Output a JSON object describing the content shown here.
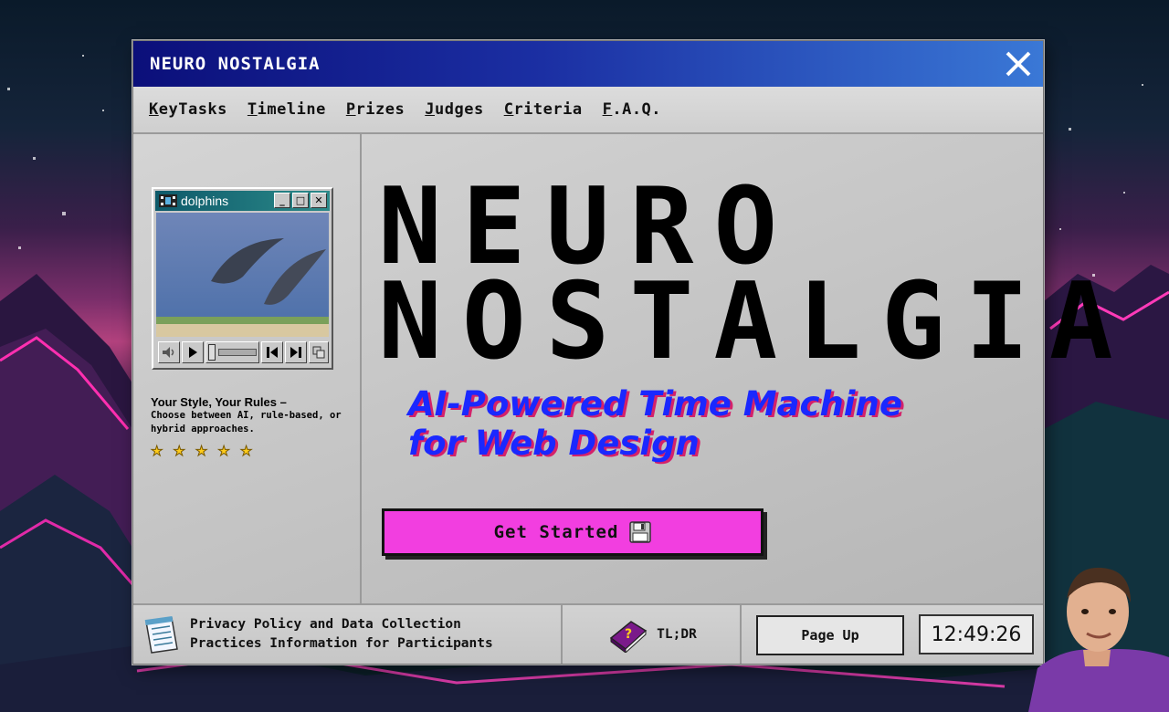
{
  "window": {
    "title": "NEURO NOSTALGIA"
  },
  "menu": {
    "items": [
      {
        "underline": "K",
        "rest": "eyTasks"
      },
      {
        "underline": "T",
        "rest": "imeline"
      },
      {
        "underline": "P",
        "rest": "rizes"
      },
      {
        "underline": "J",
        "rest": "udges"
      },
      {
        "underline": "C",
        "rest": "riteria"
      },
      {
        "underline": "F",
        "rest": ".A.Q."
      }
    ]
  },
  "media_player": {
    "title": "dolphins",
    "buttons": {
      "minimize": "_",
      "maximize": "□",
      "close": "✕"
    }
  },
  "tagline": {
    "title": "Your Style, Your Rules –",
    "body": "Choose between AI, rule-based, or hybrid approaches.",
    "rating": 5
  },
  "hero": {
    "line1": "NEURO",
    "line2": "NOSTALGIA",
    "subtitle_line1": "AI-Powered Time Machine",
    "subtitle_line2": "for Web Design",
    "cta_label": "Get Started"
  },
  "statusbar": {
    "privacy_line1": "Privacy Policy and Data Collection",
    "privacy_line2": "Practices Information for Participants",
    "tldr": "TL;DR",
    "page_up": "Page Up",
    "clock": "12:49:26"
  },
  "colors": {
    "titlebar_start": "#0b0f7a",
    "titlebar_end": "#3a78d6",
    "cta": "#f23ee0",
    "subtitle": "#1a28ff",
    "subtitle_shadow": "#d4216a"
  }
}
